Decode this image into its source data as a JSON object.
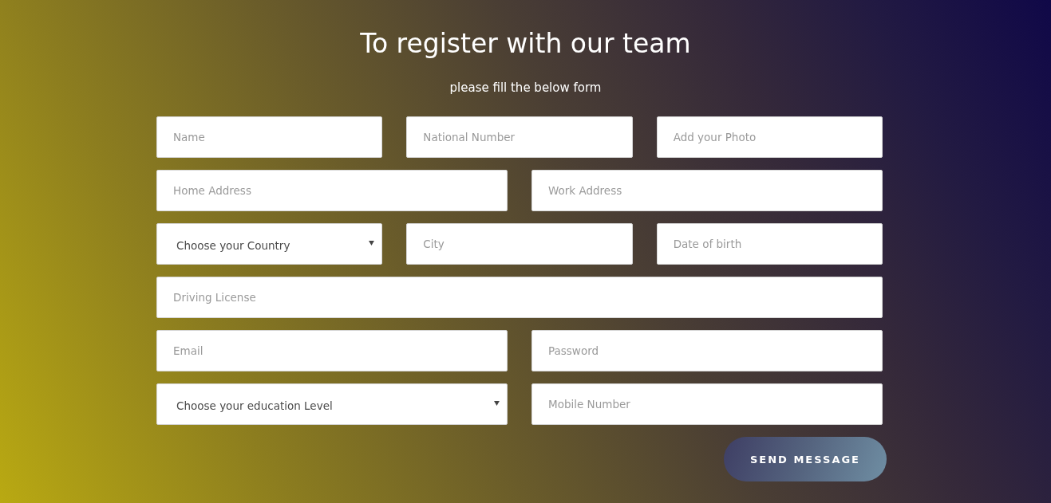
{
  "header": {
    "title": "To register with our team",
    "subtitle": "please fill the below form"
  },
  "form": {
    "rows": [
      {
        "fields": [
          {
            "kind": "input",
            "placeholder": "Name"
          },
          {
            "kind": "input",
            "placeholder": "National Number"
          },
          {
            "kind": "input",
            "placeholder": "Add your Photo"
          }
        ]
      },
      {
        "fields": [
          {
            "kind": "input",
            "placeholder": "Home Address"
          },
          {
            "kind": "input",
            "placeholder": "Work Address"
          }
        ]
      },
      {
        "fields": [
          {
            "kind": "select",
            "value": "Choose your Country"
          },
          {
            "kind": "input",
            "placeholder": "City"
          },
          {
            "kind": "input",
            "placeholder": "Date of birth"
          }
        ]
      },
      {
        "fields": [
          {
            "kind": "input",
            "placeholder": "Driving License"
          }
        ]
      },
      {
        "fields": [
          {
            "kind": "input",
            "placeholder": "Email"
          },
          {
            "kind": "input",
            "placeholder": "Password"
          }
        ]
      },
      {
        "fields": [
          {
            "kind": "select",
            "value": "Choose your education Level"
          },
          {
            "kind": "input",
            "placeholder": "Mobile Number"
          }
        ]
      }
    ],
    "submit": {
      "label": "SEND MESSAGE"
    }
  }
}
